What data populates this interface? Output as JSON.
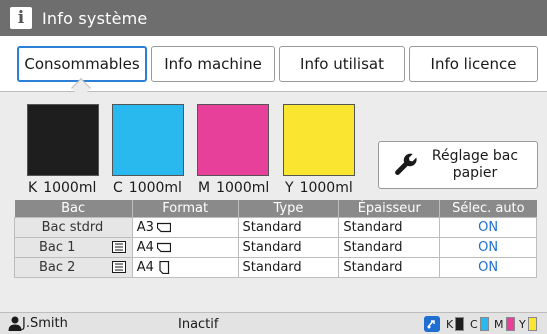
{
  "window": {
    "title": "Info système"
  },
  "tabs": [
    {
      "label": "Consommables",
      "active": true
    },
    {
      "label": "Info machine",
      "active": false
    },
    {
      "label": "Info utilisat",
      "active": false
    },
    {
      "label": "Info licence",
      "active": false
    }
  ],
  "inks": [
    {
      "letter": "K",
      "amount": "1000ml",
      "color": "#1e1e1e"
    },
    {
      "letter": "C",
      "amount": "1000ml",
      "color": "#29b9ee"
    },
    {
      "letter": "M",
      "amount": "1000ml",
      "color": "#e6409a"
    },
    {
      "letter": "Y",
      "amount": "1000ml",
      "color": "#fae531"
    }
  ],
  "adjust_button": {
    "line1": "Réglage bac",
    "line2": "papier",
    "icon": "wrench-icon"
  },
  "table": {
    "headers": [
      "Bac",
      "Format",
      "Type",
      "Épaisseur",
      "Sélec. auto"
    ],
    "rows": [
      {
        "bac": "Bac stdrd",
        "format": "A3",
        "type": "Standard",
        "thickness": "Standard",
        "auto": "ON"
      },
      {
        "bac": "Bac 1",
        "format": "A4",
        "type": "Standard",
        "thickness": "Standard",
        "auto": "ON"
      },
      {
        "bac": "Bac 2",
        "format": "A4",
        "type": "Standard",
        "thickness": "Standard",
        "auto": "ON"
      }
    ]
  },
  "status": {
    "user": "J.Smith",
    "state": "Inactif",
    "ink_letters": [
      "K",
      "C",
      "M",
      "Y"
    ]
  }
}
